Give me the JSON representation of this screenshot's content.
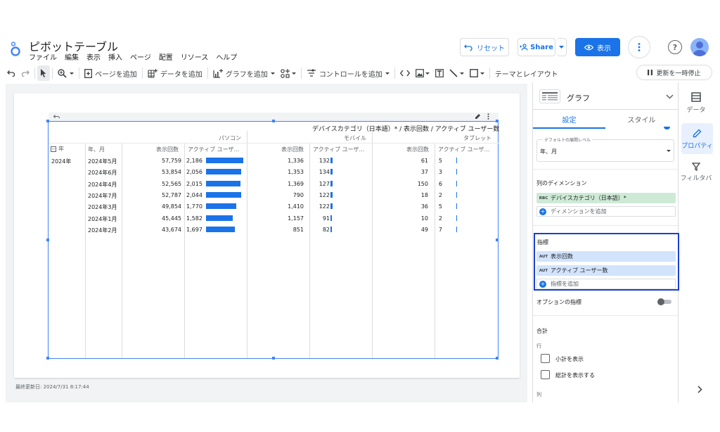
{
  "app": {
    "title": "ピボットテーブル",
    "menu": [
      "ファイル",
      "編集",
      "表示",
      "挿入",
      "ページ",
      "配置",
      "リソース",
      "ヘルプ"
    ]
  },
  "header": {
    "reset_label": "リセット",
    "share_label": "Share",
    "view_label": "表示",
    "help_label": "?"
  },
  "toolbar": {
    "add_page": "ページを追加",
    "add_data": "データを追加",
    "add_chart": "グラフを追加",
    "add_control": "コントロールを追加",
    "theme_layout": "テーマとレイアウト",
    "pause_updates": "更新を一時停止"
  },
  "canvas": {
    "last_updated": "最終更新日: 2024/7/31 8:17:44"
  },
  "pivot": {
    "title": "デバイスカテゴリ（日本語）* / 表示回数 / アクティブ ユーザー数",
    "row_headers": [
      "年",
      "年、月"
    ],
    "devices": [
      "パソコン",
      "モバイル",
      "タブレット"
    ],
    "metric_headers": [
      "表示回数",
      "アクティブ ユーザ…"
    ],
    "year": "2024年",
    "rows": [
      {
        "month": "2024年5月",
        "pc_views": "57,759",
        "pc_users": "2,186",
        "mo_views": "1,336",
        "mo_users": "132",
        "tb_views": "61",
        "tb_users": "5"
      },
      {
        "month": "2024年6月",
        "pc_views": "53,854",
        "pc_users": "2,056",
        "mo_views": "1,353",
        "mo_users": "134",
        "tb_views": "37",
        "tb_users": "3"
      },
      {
        "month": "2024年4月",
        "pc_views": "52,565",
        "pc_users": "2,015",
        "mo_views": "1,369",
        "mo_users": "127",
        "tb_views": "150",
        "tb_users": "6"
      },
      {
        "month": "2024年7月",
        "pc_views": "52,787",
        "pc_users": "2,044",
        "mo_views": "790",
        "mo_users": "122",
        "tb_views": "18",
        "tb_users": "2"
      },
      {
        "month": "2024年3月",
        "pc_views": "49,854",
        "pc_users": "1,770",
        "mo_views": "1,410",
        "mo_users": "122",
        "tb_views": "36",
        "tb_users": "5"
      },
      {
        "month": "2024年1月",
        "pc_views": "45,445",
        "pc_users": "1,582",
        "mo_views": "1,157",
        "mo_users": "91",
        "tb_views": "10",
        "tb_users": "2"
      },
      {
        "month": "2024年2月",
        "pc_views": "43,674",
        "pc_users": "1,697",
        "mo_views": "851",
        "mo_users": "82",
        "tb_views": "49",
        "tb_users": "7"
      }
    ]
  },
  "panel": {
    "chart_type": "グラフ",
    "tabs": [
      "設定",
      "スタイル"
    ],
    "default_expand_label": "デフォルトの展開レベル",
    "default_expand_value": "年、月",
    "column_dimensions_label": "列のディメンション",
    "dimension_chip": "デバイスカテゴリ（日本語）*",
    "dimension_tag": "RBC",
    "add_dimension": "ディメンションを追加",
    "metrics_label": "指標",
    "metric_tag": "AUT",
    "metrics": [
      "表示回数",
      "アクティブ ユーザー数"
    ],
    "add_metric": "指標を追加",
    "optional_metrics": "オプションの指標",
    "totals_label": "合計",
    "row_label": "行",
    "show_subtotals": "小計を表示",
    "show_grand_total": "総計を表示する",
    "column_label": "列"
  },
  "rail": {
    "data": "データ",
    "properties": "プロパティ",
    "filter": "フィルタバー"
  },
  "colors": {
    "accent": "#1a73e8",
    "bar": "#1a73e8",
    "dimension_chip": "#ceead6",
    "metric_chip": "#d2e3fc",
    "selection": "#1a3fd1"
  }
}
